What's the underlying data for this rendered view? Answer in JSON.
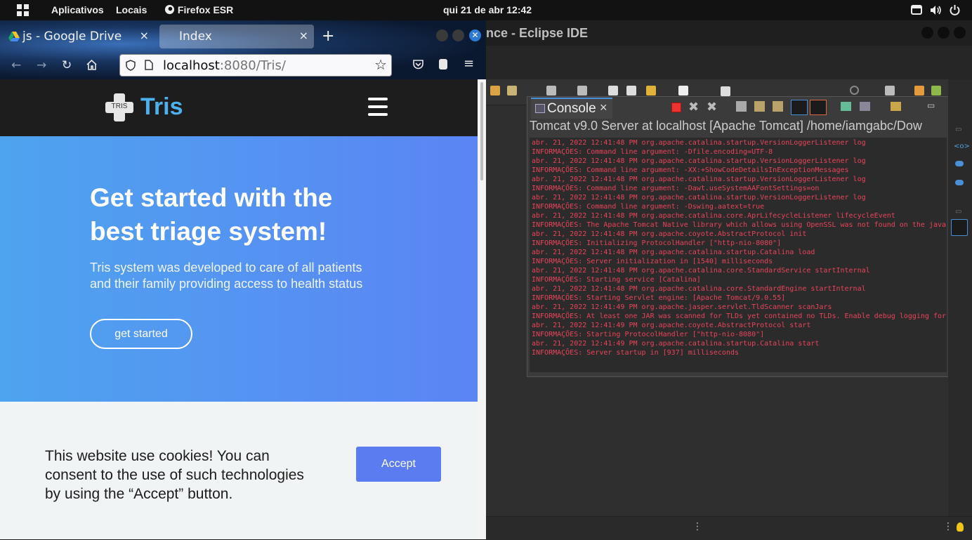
{
  "topbar": {
    "activities": "Aplicativos",
    "places": "Locais",
    "app": "Firefox ESR",
    "clock": "qui 21 de abr  12:42"
  },
  "firefox": {
    "tabs": [
      {
        "label": "js - Google Drive",
        "icon": "google-drive-icon"
      },
      {
        "label": "Index",
        "icon": ""
      }
    ],
    "url_host": "localhost",
    "url_rest": ":8080/Tris/"
  },
  "site": {
    "logo_text": "TRIS",
    "brand": "Tris",
    "hero_title": "Get started with the best triage system!",
    "hero_subtitle": "Tris system was developed to care of all patients and their family providing access to health status",
    "cta": "get started",
    "cookie_text": "This website use cookies! You can consent to the use of such technologies by using the “Accept” button.",
    "accept": "Accept"
  },
  "eclipse": {
    "title": "nce - Eclipse IDE",
    "console_tab": "Console",
    "console_header": "Tomcat v9.0 Server at localhost [Apache Tomcat] /home/iamgabc/Dow",
    "log": [
      "abr. 21, 2022 12:41:48 PM org.apache.catalina.startup.VersionLoggerListener log",
      "INFORMAÇÕES: Command line argument: -Dfile.encoding=UTF-8",
      "abr. 21, 2022 12:41:48 PM org.apache.catalina.startup.VersionLoggerListener log",
      "INFORMAÇÕES: Command line argument: -XX:+ShowCodeDetailsInExceptionMessages",
      "abr. 21, 2022 12:41:48 PM org.apache.catalina.startup.VersionLoggerListener log",
      "INFORMAÇÕES: Command line argument: -Dawt.useSystemAAFontSettings=on",
      "abr. 21, 2022 12:41:48 PM org.apache.catalina.startup.VersionLoggerListener log",
      "INFORMAÇÕES: Command line argument: -Dswing.aatext=true",
      "abr. 21, 2022 12:41:48 PM org.apache.catalina.core.AprLifecycleListener lifecycleEvent",
      "INFORMAÇÕES: The Apache Tomcat Native library which allows using OpenSSL was not found on the java",
      "abr. 21, 2022 12:41:48 PM org.apache.coyote.AbstractProtocol init",
      "INFORMAÇÕES: Initializing ProtocolHandler [\"http-nio-8080\"]",
      "abr. 21, 2022 12:41:48 PM org.apache.catalina.startup.Catalina load",
      "INFORMAÇÕES: Server initialization in [1540] milliseconds",
      "abr. 21, 2022 12:41:48 PM org.apache.catalina.core.StandardService startInternal",
      "INFORMAÇÕES: Starting service [Catalina]",
      "abr. 21, 2022 12:41:48 PM org.apache.catalina.core.StandardEngine startInternal",
      "INFORMAÇÕES: Starting Servlet engine: [Apache Tomcat/9.0.55]",
      "abr. 21, 2022 12:41:49 PM org.apache.jasper.servlet.TldScanner scanJars",
      "INFORMAÇÕES: At least one JAR was scanned for TLDs yet contained no TLDs. Enable debug logging for",
      "abr. 21, 2022 12:41:49 PM org.apache.coyote.AbstractProtocol start",
      "INFORMAÇÕES: Starting ProtocolHandler [\"http-nio-8080\"]",
      "abr. 21, 2022 12:41:49 PM org.apache.catalina.startup.Catalina start",
      "INFORMAÇÕES: Server startup in [937] milliseconds"
    ]
  }
}
